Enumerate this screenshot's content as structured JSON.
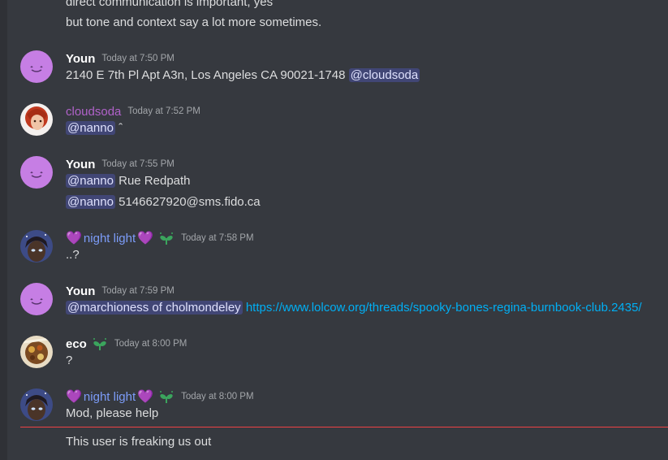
{
  "top_lines": [
    "direct communication is important, yes",
    "but tone and context say a lot more sometimes."
  ],
  "messages": [
    {
      "author": "Youn",
      "time": "Today at 7:50 PM",
      "line1_text": "2140 E 7th Pl Apt A3n, Los Angeles CA 90021-1748",
      "line1_mention": "@cloudsoda"
    },
    {
      "author": "cloudsoda",
      "time": "Today at 7:52 PM",
      "line1_mention": "@nanno",
      "line1_text": "ˆ"
    },
    {
      "author": "Youn",
      "time": "Today at 7:55 PM",
      "line1_mention": "@nanno",
      "line1_text": "Rue Redpath",
      "line2_mention": "@nanno",
      "line2_text": "5146627920@sms.fido.ca"
    },
    {
      "author": "night light",
      "heart_left": "💜",
      "heart_right": "💜",
      "time": "Today at 7:58 PM",
      "line1_text": "..?"
    },
    {
      "author": "Youn",
      "time": "Today at 7:59 PM",
      "line1_mention": "@marchioness of cholmondeley",
      "line1_link": "https://www.lolcow.org/threads/spooky-bones-regina-burnbook-club.2435/"
    },
    {
      "author": "eco",
      "time": "Today at 8:00 PM",
      "line1_text": "?"
    },
    {
      "author": "night light",
      "heart_left": "💜",
      "heart_right": "💜",
      "time": "Today at 8:00 PM",
      "line1_text": "Mod, please help",
      "line2_text": "This user is freaking us out"
    }
  ],
  "colors": {
    "background": "#36393f",
    "mention_bg": "#414675",
    "link": "#00aff4",
    "new_messages_divider": "#ed4245",
    "cloudsoda_name": "#b062c9",
    "nightlight_name": "#7c9cf8"
  },
  "icons": {
    "badge": "sprout-icon",
    "youn_avatar": "smiley-blob-avatar"
  }
}
